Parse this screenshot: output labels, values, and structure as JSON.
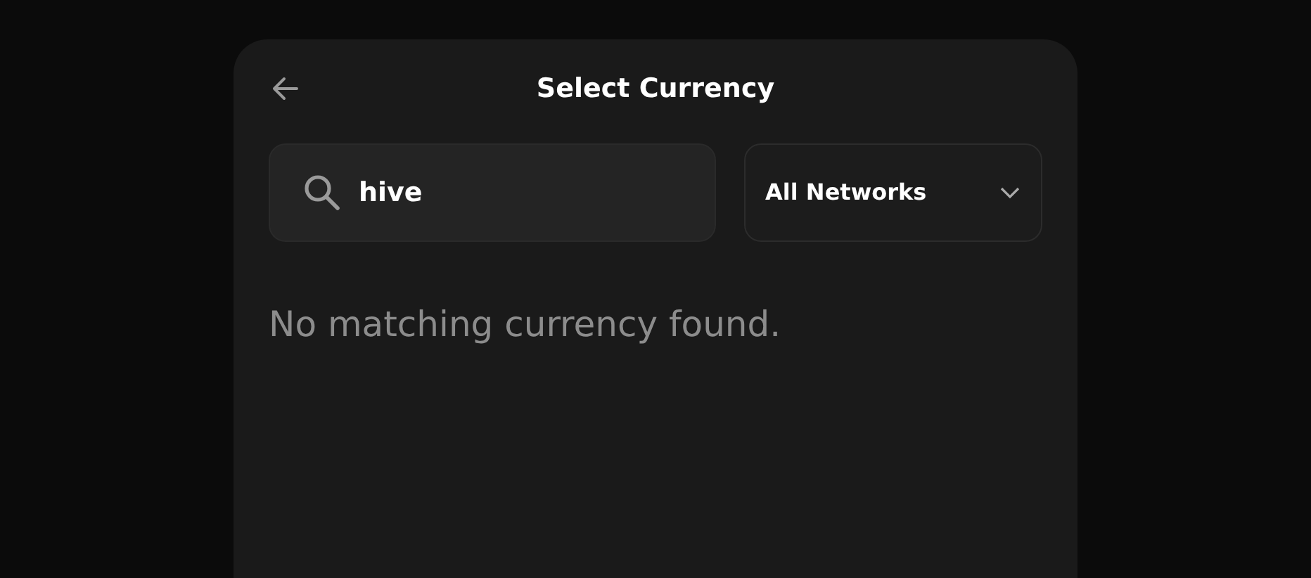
{
  "header": {
    "title": "Select Currency"
  },
  "search": {
    "value": "hive"
  },
  "network_filter": {
    "value": "All Networks"
  },
  "empty_message": "No matching currency found."
}
